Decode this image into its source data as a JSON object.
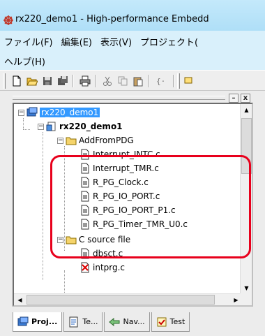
{
  "window": {
    "title": "rx220_demo1 - High-performance Embedd"
  },
  "menu": {
    "row1": [
      "ファイル(F)",
      "編集(E)",
      "表示(V)",
      "プロジェクト("
    ],
    "row2": [
      "ヘルプ(H)"
    ]
  },
  "toolbar": {
    "buttons": [
      "new-file-icon",
      "open-folder-icon",
      "save-icon",
      "save-all-icon",
      "print-icon",
      "cut-icon",
      "copy-icon",
      "paste-icon",
      "bookmark-icon",
      "project-icon"
    ]
  },
  "pane": {
    "buttons": {
      "minimize": "–",
      "close": "x"
    },
    "tree": {
      "workspace": "rx220_demo1",
      "project": "rx220_demo1",
      "folder1": "AddFromPDG",
      "files1": [
        "Interrupt_INTC.c",
        "Interrupt_TMR.c",
        "R_PG_Clock.c",
        "R_PG_IO_PORT.c",
        "R_PG_IO_PORT_P1.c",
        "R_PG_Timer_TMR_U0.c"
      ],
      "folder2": "C source file",
      "files2": [
        "dbsct.c",
        "intprg.c"
      ]
    }
  },
  "tabs": [
    {
      "label": "Proj...",
      "icon": "project-tree-icon",
      "active": true
    },
    {
      "label": "Te...",
      "icon": "template-icon",
      "active": false
    },
    {
      "label": "Nav...",
      "icon": "navigation-icon",
      "active": false
    },
    {
      "label": "Test",
      "icon": "test-icon",
      "active": false
    }
  ],
  "colors": {
    "selection": "#3399ff",
    "highlight": "#e8001c",
    "titlebar": "#a9dcf6"
  }
}
